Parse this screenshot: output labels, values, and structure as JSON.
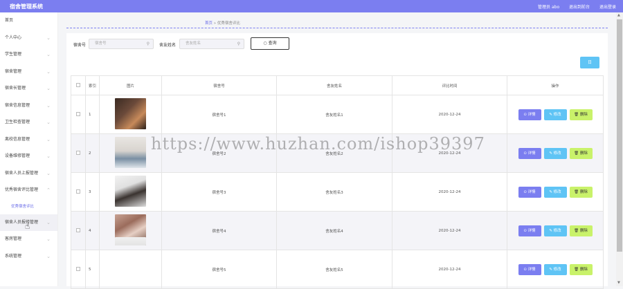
{
  "header": {
    "title": "宿舍管理系统",
    "user_label": "管理员 abo",
    "exit_to_front": "退出到前台",
    "logout": "退出登录"
  },
  "sidebar": {
    "items": [
      {
        "label": "首页"
      },
      {
        "label": "个人中心"
      },
      {
        "label": "学生管理"
      },
      {
        "label": "宿舍管理"
      },
      {
        "label": "宿舍长管理"
      },
      {
        "label": "宿舍信息管理"
      },
      {
        "label": "卫生检查管理"
      },
      {
        "label": "离校信息管理"
      },
      {
        "label": "设备维修管理"
      },
      {
        "label": "宿舍人员上报管理"
      },
      {
        "label": "优秀宿舍评比管理"
      },
      {
        "label": "优秀宿舍评比",
        "sub": true
      },
      {
        "label": "宿舍人员报修管理"
      },
      {
        "label": "客房管理"
      },
      {
        "label": "系统管理"
      }
    ]
  },
  "breadcrumb": {
    "home": "首页",
    "separator": "»",
    "current": "优秀宿舍评比"
  },
  "search": {
    "dorm_label": "宿舍号",
    "dorm_placeholder": "宿舍号",
    "member_label": "舍友姓名",
    "member_placeholder": "舍友姓名",
    "query_button": "查询"
  },
  "toolbar": {
    "add_button": "日"
  },
  "table": {
    "headers": [
      "",
      "索引",
      "图片",
      "宿舍号",
      "舍友姓名",
      "评比时间",
      "操作"
    ],
    "rows": [
      {
        "index": "1",
        "dorm": "宿舍号1",
        "member": "舍友姓名1",
        "date": "2020-12-24"
      },
      {
        "index": "2",
        "dorm": "宿舍号2",
        "member": "舍友姓名2",
        "date": "2020-12-24"
      },
      {
        "index": "3",
        "dorm": "宿舍号3",
        "member": "舍友姓名3",
        "date": "2020-12-24"
      },
      {
        "index": "4",
        "dorm": "宿舍号4",
        "member": "舍友姓名4",
        "date": "2020-12-24"
      },
      {
        "index": "5",
        "dorm": "宿舍号5",
        "member": "舍友姓名5",
        "date": "2020-12-24"
      }
    ],
    "actions": {
      "detail": "⊙ 详情",
      "edit": "✎ 修改",
      "delete": "🗑 删除"
    }
  },
  "watermark": "https://www.huzhan.com/ishop39397",
  "colors": {
    "primary": "#7b7ef0",
    "edit": "#5fc4f5",
    "delete": "#c9f26a"
  }
}
